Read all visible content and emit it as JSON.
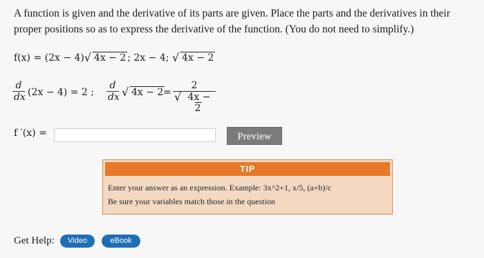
{
  "question": {
    "text": "A function is given and the derivative of its parts are given. Place the parts and the derivatives in their proper positions so as to express the derivative of the function. (You do not need to simplify.)"
  },
  "given": {
    "f_lhs": "f(x) = (2x − 4)",
    "sqrt_arg": "4x − 2",
    "parts_mid": "; 2x − 4;",
    "sqrt_arg2": "4x − 2"
  },
  "derivatives": {
    "d": "d",
    "dx": "dx",
    "expr1": "(2x − 4) = 2 ;",
    "sqrt_arg": "4x − 2",
    "equals": "=",
    "num": "2",
    "den_sqrt_arg": "4x − 2"
  },
  "answer": {
    "label": "f ′(x) =",
    "value": ""
  },
  "preview_label": "Preview",
  "tip": {
    "header": "TIP",
    "line1": "Enter your answer as an expression. Example: 3x^2+1, x/5, (a+b)/c",
    "line2": "Be sure your variables match those in the question"
  },
  "help": {
    "label": "Get Help:",
    "video": "Video",
    "ebook": "eBook"
  },
  "colors": {
    "preview_button": "#7b7b7b",
    "tip_header": "#e7792b",
    "tip_background": "#f4d9c2",
    "help_button": "#1f6fb5"
  }
}
